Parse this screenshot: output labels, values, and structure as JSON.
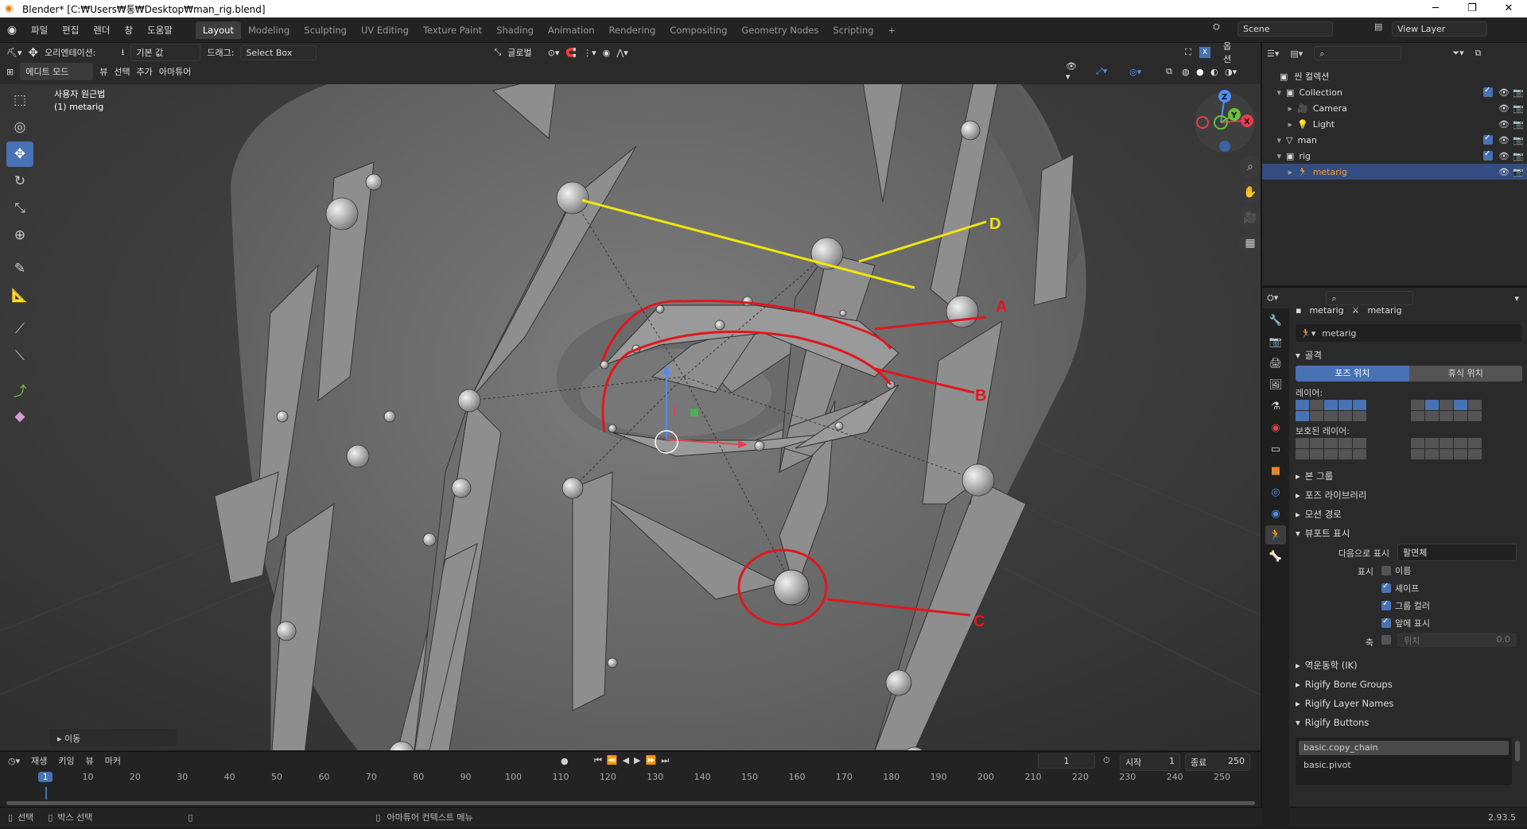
{
  "window": {
    "title": "Blender* [C:₩Users₩통₩Desktop₩man_rig.blend]",
    "minimize": "─",
    "maximize": "❐",
    "close": "✕"
  },
  "menus": [
    "파일",
    "편집",
    "렌더",
    "창",
    "도움말"
  ],
  "workspaces": [
    "Layout",
    "Modeling",
    "Sculpting",
    "UV Editing",
    "Texture Paint",
    "Shading",
    "Animation",
    "Rendering",
    "Compositing",
    "Geometry Nodes",
    "Scripting"
  ],
  "active_workspace": "Layout",
  "scene": {
    "name": "Scene",
    "view_layer": "View Layer"
  },
  "viewport_header": {
    "orientation_label": "오리엔테이션:",
    "orientation_value": "기본 값",
    "drag_label": "드래그:",
    "drag_value": "Select Box",
    "transform_orientation": "글로벌",
    "options": "옵션",
    "mode": "에디트 모드",
    "menu_items": [
      "뷰",
      "선택",
      "추가",
      "아마튜어"
    ]
  },
  "viewport": {
    "perspective": "사용자 원근법",
    "object": "(1) metarig",
    "last_op": "이동",
    "annotations": [
      "A",
      "B",
      "C",
      "D"
    ],
    "gizmo_axes": [
      "Z",
      "Y",
      "X"
    ],
    "colors": {
      "annot_red": "#e0171d",
      "annot_yellow": "#f1e70a",
      "bg": "#3d3d3d",
      "mesh": "#7a7a7a"
    }
  },
  "timeline": {
    "menus": [
      "재생",
      "키잉",
      "뷰",
      "마커"
    ],
    "current_frame": "1",
    "start_label": "시작",
    "start": "1",
    "end_label": "종료",
    "end": "250",
    "ticks": [
      "1",
      "10",
      "20",
      "30",
      "40",
      "50",
      "60",
      "70",
      "80",
      "90",
      "100",
      "110",
      "120",
      "130",
      "140",
      "150",
      "160",
      "170",
      "180",
      "190",
      "200",
      "210",
      "220",
      "230",
      "240",
      "250"
    ]
  },
  "statusbar": {
    "select": "선택",
    "box_select": "박스 선택",
    "context": "아마튜어 컨텍스트 메뉴",
    "version": "2.93.5"
  },
  "outliner": {
    "root": "씬 컬렉션",
    "items": [
      {
        "name": "Collection",
        "indent": 1
      },
      {
        "name": "Camera",
        "indent": 2
      },
      {
        "name": "Light",
        "indent": 2
      },
      {
        "name": "man",
        "indent": 1
      },
      {
        "name": "rig",
        "indent": 1
      },
      {
        "name": "metarig",
        "indent": 2,
        "selected": true
      }
    ]
  },
  "properties": {
    "breadcrumb_object": "metarig",
    "breadcrumb_data": "metarig",
    "data_name": "metarig",
    "skeleton": "골격",
    "pose_position": "포즈 위치",
    "rest_position": "휴식 위치",
    "layers": "레이어:",
    "protected_layers": "보호된 레이어:",
    "bone_groups": "본 그룹",
    "pose_library": "포즈 라이브러리",
    "motion_paths": "모션 경로",
    "viewport_display": "뷰포트 표시",
    "display_as_label": "다음으로 표시",
    "display_as": "팔면체",
    "show_label": "표시",
    "names": "이름",
    "shapes": "셰이프",
    "group_colors": "그룹 컬러",
    "in_front": "앞에 표시",
    "axes_label": "축",
    "position_label": "위치",
    "position_value": "0.0",
    "ik": "역운동학 (IK)",
    "rigify_bone_groups": "Rigify Bone Groups",
    "rigify_layer_names": "Rigify Layer Names",
    "rigify_buttons": "Rigify Buttons",
    "rigify_list": [
      "basic.copy_chain",
      "basic.pivot"
    ]
  }
}
